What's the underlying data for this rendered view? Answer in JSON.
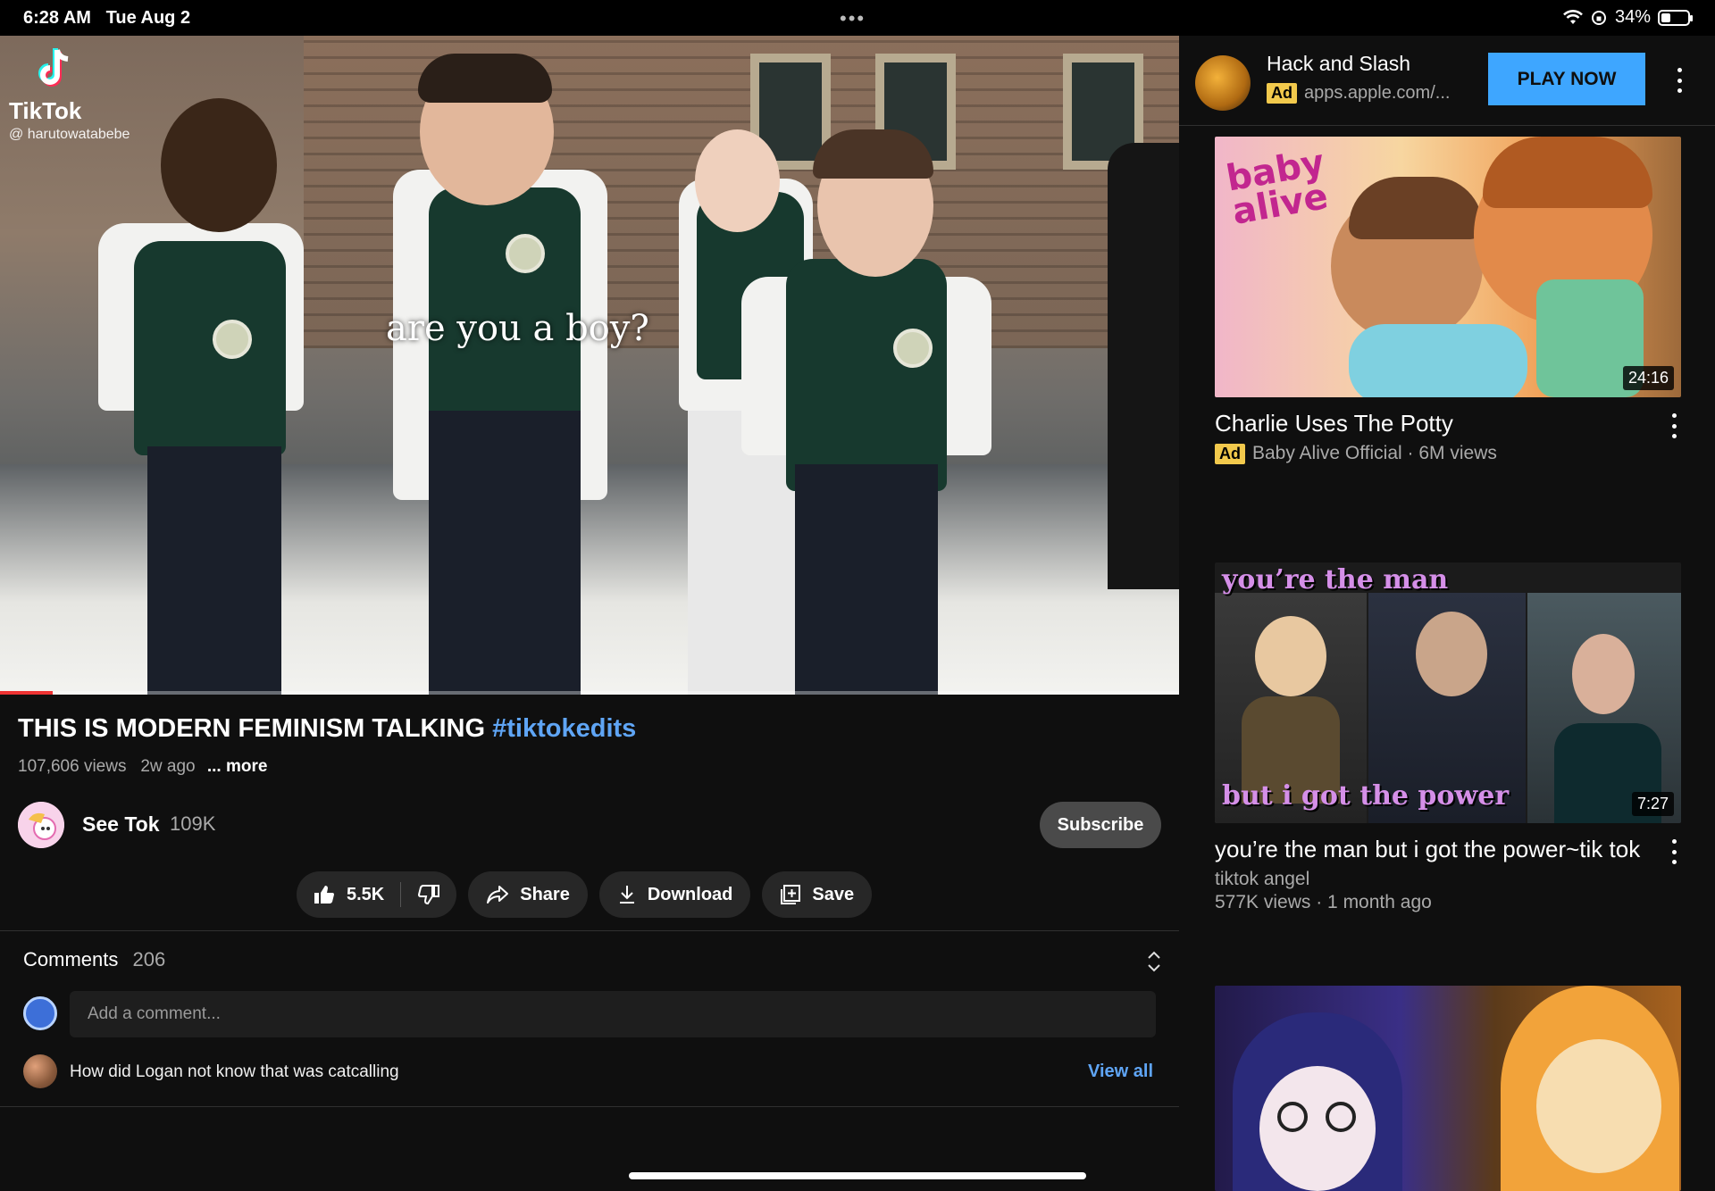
{
  "status": {
    "time": "6:28 AM",
    "date": "Tue Aug 2",
    "dots": "•••",
    "battery": "34%",
    "battery_level": 0.34
  },
  "player": {
    "caption": "are you a boy?",
    "watermark_brand": "TikTok",
    "watermark_user": "@ harutowatabebe",
    "progress": 0.045
  },
  "video": {
    "title": "THIS IS MODERN FEMINISM TALKING",
    "hashtag": "#tiktokedits",
    "views": "107,606 views",
    "age": "2w ago",
    "more": "... more"
  },
  "channel": {
    "name": "See Tok",
    "subs": "109K",
    "subscribe": "Subscribe"
  },
  "actions": {
    "likes": "5.5K",
    "share": "Share",
    "download": "Download",
    "save": "Save"
  },
  "comments": {
    "label": "Comments",
    "count": "206",
    "placeholder": "Add a comment...",
    "top": "How did Logan not know that was catcalling",
    "view_all": "View all"
  },
  "ad": {
    "title": "Hack and Slash",
    "tag": "Ad",
    "url": "apps.apple.com/...",
    "cta": "PLAY NOW"
  },
  "recommendations": [
    {
      "title": "Charlie Uses The Potty",
      "ad": "Ad",
      "meta": "Baby Alive Official · 6M views",
      "duration": "24:16",
      "thumb_text": "baby alive"
    },
    {
      "title": "you’re the man but i got the power~tik tok",
      "channel": "tiktok angel",
      "meta": "577K views · 1 month ago",
      "duration": "7:27",
      "thumb_top": "you’re the man",
      "thumb_bottom": "but i got the power"
    },
    {
      "title": "",
      "meta": ""
    }
  ],
  "colors": {
    "accent_blue": "#3ea6ff",
    "link_blue": "#5fa5f5",
    "ad_yellow": "#f2c94c",
    "progress_red": "#e33333"
  }
}
